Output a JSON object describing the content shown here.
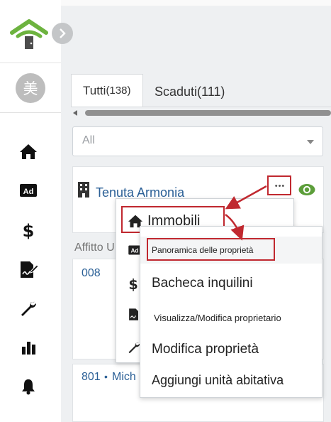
{
  "colors": {
    "accent_red": "#c0282f",
    "link_blue": "#2a5f96",
    "logo_green": "#6db33f",
    "eye_green": "#5c9e3a",
    "background_gray": "#eef0f2"
  },
  "sidebar": {
    "avatar_char": "美",
    "items": [
      {
        "icon": "home-icon"
      },
      {
        "icon": "ad-icon"
      },
      {
        "icon": "dollar-icon"
      },
      {
        "icon": "signature-icon"
      },
      {
        "icon": "wrench-icon"
      },
      {
        "icon": "chart-icon"
      },
      {
        "icon": "bell-icon"
      }
    ]
  },
  "tabs": [
    {
      "label": "Tutti",
      "count": "(138)"
    },
    {
      "label": "Scaduti",
      "count": "(111)"
    }
  ],
  "filter": {
    "selected": "All"
  },
  "property": {
    "name": "Tenuta Armonia"
  },
  "section_label": "Affitto U",
  "units": [
    {
      "number": "008"
    },
    {
      "number": "801",
      "separator": "•",
      "tenant": "Mich"
    }
  ],
  "menu_primary": {
    "title": "Immobili"
  },
  "menu_secondary": {
    "items": [
      "Panoramica delle proprietà",
      "Bacheca inquilini",
      "Visualizza/Modifica proprietario",
      "Modifica proprietà",
      "Aggiungi unità abitativa"
    ]
  },
  "more_button": {
    "label": "•••"
  }
}
